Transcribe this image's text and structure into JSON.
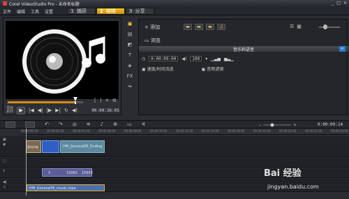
{
  "app": {
    "title": "Corel VideoStudio Pro - 未命名标题"
  },
  "menu": [
    "文件",
    "编辑",
    "工具",
    "设置"
  ],
  "steps": [
    {
      "num": "1",
      "label": "捕获",
      "active": false
    },
    {
      "num": "2",
      "label": "编辑",
      "active": true
    },
    {
      "num": "3",
      "label": "分享",
      "active": false
    }
  ],
  "preview": {
    "project_label": "项目",
    "clip_label": "素材",
    "timecode": "00:00:36:05"
  },
  "library": {
    "add_label": "添加",
    "browse_label": "浏览",
    "audio_section_title": "音乐和语音",
    "duration": "0:00:09:00",
    "volume": "100",
    "speed_label": "速度/时间流逝",
    "audio_filter_label": "音频滤镜"
  },
  "timeline": {
    "timecode": "0:00:09:14",
    "ruler": [
      "00:00:00:00",
      "00:00:02:00",
      "00:00:04:00",
      "00:00:06:00",
      "00:00:08:00",
      "00:00:10:00",
      "00:00:12:00",
      "00:00:14:00",
      "00:00:16:00",
      "00:00:18:00",
      "00:00:20:00",
      "00:00:22:00",
      "00:00:24:00"
    ],
    "video_clip_thumb": "滚动作者",
    "video_clip_label": "HM_General06_Ending",
    "overlay_values": [
      "3",
      "15062",
      "15603"
    ],
    "music_clip_label": "HM_General06_music.mpa"
  },
  "colors": {
    "accent": "#f3c21c",
    "clip_blue": "#3e74b8",
    "clip_teal": "#5a8aa0",
    "clip_purple": "#5c5c96",
    "music_clip": "#4a6fb2"
  },
  "watermark": {
    "brand": "Bai 经验",
    "url": "jingyan.baidu.com"
  }
}
